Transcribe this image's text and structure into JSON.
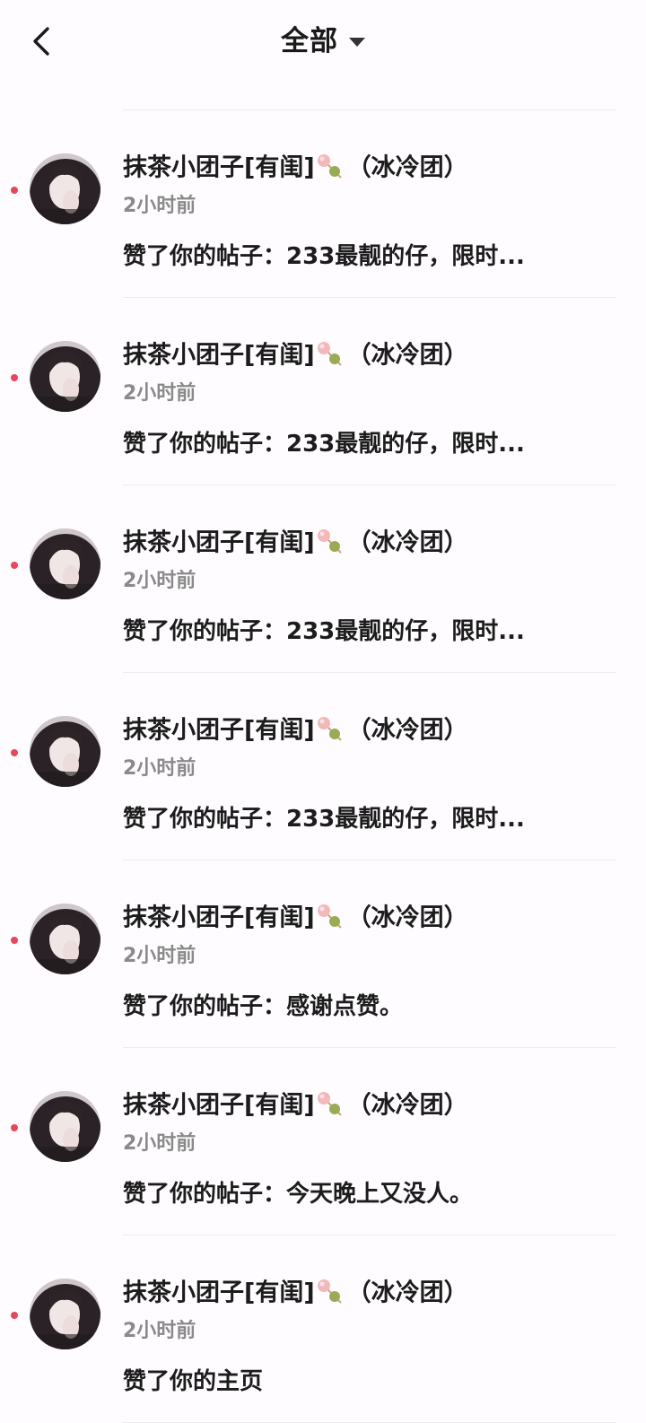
{
  "header": {
    "back_icon": "chevron-left-icon",
    "title": "全部",
    "dropdown_icon": "caret-down-icon"
  },
  "notifications": [
    {
      "nickname": "抹茶小团子[有闺]",
      "group": "（冰冷团）",
      "time": "2小时前",
      "content": "赞了你的帖子：233最靓的仔，限时..."
    },
    {
      "nickname": "抹茶小团子[有闺]",
      "group": "（冰冷团）",
      "time": "2小时前",
      "content": "赞了你的帖子：233最靓的仔，限时..."
    },
    {
      "nickname": "抹茶小团子[有闺]",
      "group": "（冰冷团）",
      "time": "2小时前",
      "content": "赞了你的帖子：233最靓的仔，限时..."
    },
    {
      "nickname": "抹茶小团子[有闺]",
      "group": "（冰冷团）",
      "time": "2小时前",
      "content": "赞了你的帖子：233最靓的仔，限时..."
    },
    {
      "nickname": "抹茶小团子[有闺]",
      "group": "（冰冷团）",
      "time": "2小时前",
      "content": "赞了你的帖子：感谢点赞。"
    },
    {
      "nickname": "抹茶小团子[有闺]",
      "group": "（冰冷团）",
      "time": "2小时前",
      "content": "赞了你的帖子：今天晚上又没人。"
    },
    {
      "nickname": "抹茶小团子[有闺]",
      "group": "（冰冷团）",
      "time": "2小时前",
      "content": "赞了你的主页"
    }
  ],
  "colors": {
    "background": "#fefcfe",
    "unread_dot": "#e8475b",
    "time_text": "#8a8a8a",
    "primary_text": "#1c1c1c"
  }
}
